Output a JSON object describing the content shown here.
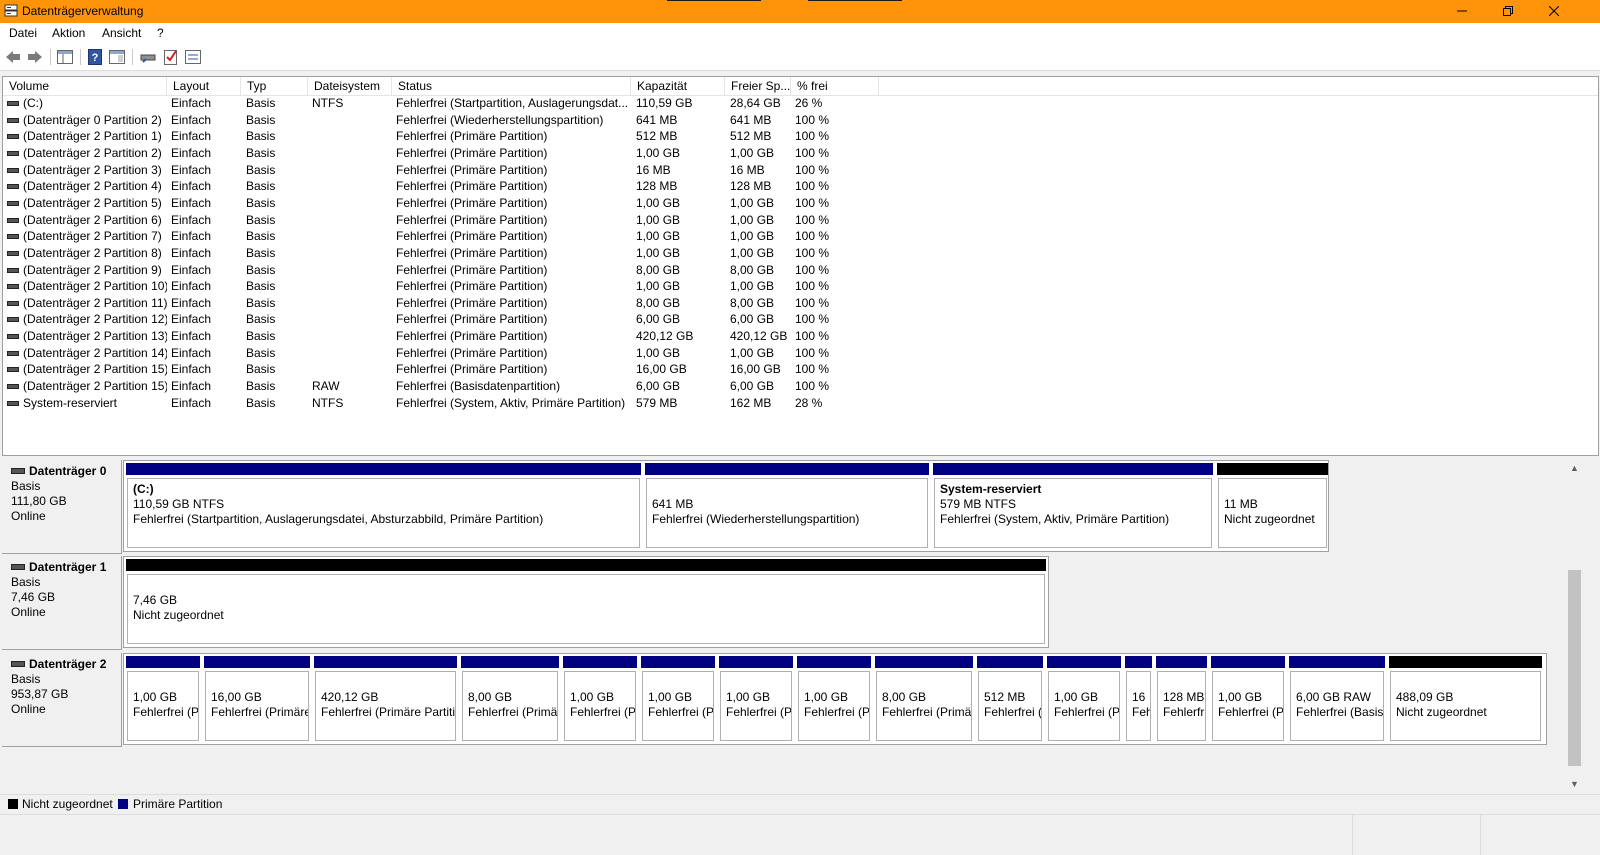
{
  "window": {
    "title": "Datenträgerverwaltung"
  },
  "menu": [
    "Datei",
    "Aktion",
    "Ansicht",
    "?"
  ],
  "colors": {
    "titlebar": "#ff9409",
    "primary": "#000080",
    "unallocated": "#000000"
  },
  "toolbar_icons": [
    "back-arrow-icon",
    "forward-arrow-icon",
    "console-tree-icon",
    "help-icon",
    "properties-icon",
    "disk-icon",
    "checklist-icon",
    "settings-panel-icon"
  ],
  "list": {
    "headers": [
      "Volume",
      "Layout",
      "Typ",
      "Dateisystem",
      "Status",
      "Kapazität",
      "Freier Sp...",
      "% frei"
    ],
    "rows": [
      [
        "(C:)",
        "Einfach",
        "Basis",
        "NTFS",
        "Fehlerfrei (Startpartition, Auslagerungsdat...",
        "110,59 GB",
        "28,64 GB",
        "26 %"
      ],
      [
        "(Datenträger 0 Partition 2)",
        "Einfach",
        "Basis",
        "",
        "Fehlerfrei (Wiederherstellungspartition)",
        "641 MB",
        "641 MB",
        "100 %"
      ],
      [
        "(Datenträger 2 Partition 1)",
        "Einfach",
        "Basis",
        "",
        "Fehlerfrei (Primäre Partition)",
        "512 MB",
        "512 MB",
        "100 %"
      ],
      [
        "(Datenträger 2 Partition 2)",
        "Einfach",
        "Basis",
        "",
        "Fehlerfrei (Primäre Partition)",
        "1,00 GB",
        "1,00 GB",
        "100 %"
      ],
      [
        "(Datenträger 2 Partition 3)",
        "Einfach",
        "Basis",
        "",
        "Fehlerfrei (Primäre Partition)",
        "16 MB",
        "16 MB",
        "100 %"
      ],
      [
        "(Datenträger 2 Partition 4)",
        "Einfach",
        "Basis",
        "",
        "Fehlerfrei (Primäre Partition)",
        "128 MB",
        "128 MB",
        "100 %"
      ],
      [
        "(Datenträger 2 Partition 5)",
        "Einfach",
        "Basis",
        "",
        "Fehlerfrei (Primäre Partition)",
        "1,00 GB",
        "1,00 GB",
        "100 %"
      ],
      [
        "(Datenträger 2 Partition 6)",
        "Einfach",
        "Basis",
        "",
        "Fehlerfrei (Primäre Partition)",
        "1,00 GB",
        "1,00 GB",
        "100 %"
      ],
      [
        "(Datenträger 2 Partition 7)",
        "Einfach",
        "Basis",
        "",
        "Fehlerfrei (Primäre Partition)",
        "1,00 GB",
        "1,00 GB",
        "100 %"
      ],
      [
        "(Datenträger 2 Partition 8)",
        "Einfach",
        "Basis",
        "",
        "Fehlerfrei (Primäre Partition)",
        "1,00 GB",
        "1,00 GB",
        "100 %"
      ],
      [
        "(Datenträger 2 Partition 9)",
        "Einfach",
        "Basis",
        "",
        "Fehlerfrei (Primäre Partition)",
        "8,00 GB",
        "8,00 GB",
        "100 %"
      ],
      [
        "(Datenträger 2 Partition 10)",
        "Einfach",
        "Basis",
        "",
        "Fehlerfrei (Primäre Partition)",
        "1,00 GB",
        "1,00 GB",
        "100 %"
      ],
      [
        "(Datenträger 2 Partition 11)",
        "Einfach",
        "Basis",
        "",
        "Fehlerfrei (Primäre Partition)",
        "8,00 GB",
        "8,00 GB",
        "100 %"
      ],
      [
        "(Datenträger 2 Partition 12)",
        "Einfach",
        "Basis",
        "",
        "Fehlerfrei (Primäre Partition)",
        "6,00 GB",
        "6,00 GB",
        "100 %"
      ],
      [
        "(Datenträger 2 Partition 13)",
        "Einfach",
        "Basis",
        "",
        "Fehlerfrei (Primäre Partition)",
        "420,12 GB",
        "420,12 GB",
        "100 %"
      ],
      [
        "(Datenträger 2 Partition 14)",
        "Einfach",
        "Basis",
        "",
        "Fehlerfrei (Primäre Partition)",
        "1,00 GB",
        "1,00 GB",
        "100 %"
      ],
      [
        "(Datenträger 2 Partition 15)",
        "Einfach",
        "Basis",
        "",
        "Fehlerfrei (Primäre Partition)",
        "16,00 GB",
        "16,00 GB",
        "100 %"
      ],
      [
        "(Datenträger 2 Partition 15)",
        "Einfach",
        "Basis",
        "RAW",
        "Fehlerfrei (Basisdatenpartition)",
        "6,00 GB",
        "6,00 GB",
        "100 %"
      ],
      [
        "System-reserviert",
        "Einfach",
        "Basis",
        "NTFS",
        "Fehlerfrei (System, Aktiv, Primäre Partition)",
        "579 MB",
        "162 MB",
        "28 %"
      ]
    ]
  },
  "disks": [
    {
      "name": "Datenträger 0",
      "type": "Basis",
      "size": "111,80 GB",
      "state": "Online",
      "partitions": [
        {
          "kind": "primary",
          "name": "(C:)",
          "line1": "110,59 GB NTFS",
          "line2": "Fehlerfrei (Startpartition, Auslagerungsdatei, Absturzabbild, Primäre Partition)"
        },
        {
          "kind": "primary",
          "name": "",
          "line1": "641 MB",
          "line2": "Fehlerfrei (Wiederherstellungspartition)"
        },
        {
          "kind": "primary",
          "name": "System-reserviert",
          "line1": "579 MB NTFS",
          "line2": "Fehlerfrei (System, Aktiv, Primäre Partition)"
        },
        {
          "kind": "unalloc",
          "name": "",
          "line1": "11 MB",
          "line2": "Nicht zugeordnet"
        }
      ]
    },
    {
      "name": "Datenträger 1",
      "type": "Basis",
      "size": "7,46 GB",
      "state": "Online",
      "partitions": [
        {
          "kind": "unalloc",
          "name": "",
          "line1": "7,46 GB",
          "line2": "Nicht zugeordnet"
        }
      ]
    },
    {
      "name": "Datenträger 2",
      "type": "Basis",
      "size": "953,87 GB",
      "state": "Online",
      "partitions": [
        {
          "kind": "primary",
          "name": "",
          "line1": "1,00 GB",
          "line2": "Fehlerfrei (P"
        },
        {
          "kind": "primary",
          "name": "",
          "line1": "16,00 GB",
          "line2": "Fehlerfrei (Primäre"
        },
        {
          "kind": "primary",
          "name": "",
          "line1": "420,12 GB",
          "line2": "Fehlerfrei (Primäre Partitio"
        },
        {
          "kind": "primary",
          "name": "",
          "line1": "8,00 GB",
          "line2": "Fehlerfrei (Primä"
        },
        {
          "kind": "primary",
          "name": "",
          "line1": "1,00 GB",
          "line2": "Fehlerfrei (P"
        },
        {
          "kind": "primary",
          "name": "",
          "line1": "1,00 GB",
          "line2": "Fehlerfrei (P"
        },
        {
          "kind": "primary",
          "name": "",
          "line1": "1,00 GB",
          "line2": "Fehlerfrei (P"
        },
        {
          "kind": "primary",
          "name": "",
          "line1": "1,00 GB",
          "line2": "Fehlerfrei (P"
        },
        {
          "kind": "primary",
          "name": "",
          "line1": "8,00 GB",
          "line2": "Fehlerfrei (Primä"
        },
        {
          "kind": "primary",
          "name": "",
          "line1": "512 MB",
          "line2": "Fehlerfrei ("
        },
        {
          "kind": "primary",
          "name": "",
          "line1": "1,00 GB",
          "line2": "Fehlerfrei (P"
        },
        {
          "kind": "primary",
          "name": "",
          "line1": "16",
          "line2": "Feh"
        },
        {
          "kind": "primary",
          "name": "",
          "line1": "128 MB",
          "line2": "Fehlerfr"
        },
        {
          "kind": "primary",
          "name": "",
          "line1": "1,00 GB",
          "line2": "Fehlerfrei (P"
        },
        {
          "kind": "primary",
          "name": "",
          "line1": "6,00 GB RAW",
          "line2": "Fehlerfrei (Basisc"
        },
        {
          "kind": "unalloc",
          "name": "",
          "line1": "488,09 GB",
          "line2": "Nicht zugeordnet"
        }
      ]
    }
  ],
  "legend": [
    {
      "label": "Nicht zugeordnet",
      "color": "#000000"
    },
    {
      "label": "Primäre Partition",
      "color": "#000080"
    }
  ]
}
